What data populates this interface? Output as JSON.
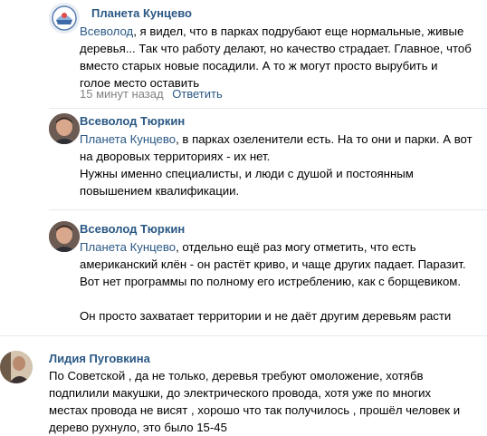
{
  "comments": [
    {
      "author": "Планета Кунцево",
      "mention": "Всеволод",
      "lines": [
        ", я видел, что в парках подрубают еще нормальные, живые",
        "деревья... Так что работу делают, но качество страдает. Главное, чтоб",
        "вместо старых новые посадили. А то ж могут просто вырубить и",
        "голое место оставить"
      ],
      "time": "15 минут назад",
      "reply_label": "Ответить"
    },
    {
      "author": "Всеволод Тюркин",
      "mention": "Планета Кунцево",
      "lines": [
        ", в парках озеленители есть. На то они и парки. А вот",
        "на дворовых территориях - их нет.",
        "Нужны именно специалисты, и люди с душой и постоянным",
        "повышением квалификации."
      ]
    },
    {
      "author": "Всеволод Тюркин",
      "mention": "Планета Кунцево",
      "lines": [
        ", отдельно ещё раз могу отметить, что есть",
        "американский клён - он растёт криво, и чаще других падает. Паразит.",
        "Вот нет программы по полному его истреблению, как с борщевиком.",
        "",
        "Он просто захватает территории и не даёт другим деревьям расти"
      ]
    },
    {
      "author": "Лидия Пуговкина",
      "lines": [
        "По Советской , да не только, деревья требуют омоложение, хотябв",
        "подпилили макушки, до электрического провода, хотя уже по многих",
        "местах провода не висят , хорошо что так получилось , прошёл человек и",
        "дерево рухнуло, это было 15-45"
      ]
    }
  ]
}
